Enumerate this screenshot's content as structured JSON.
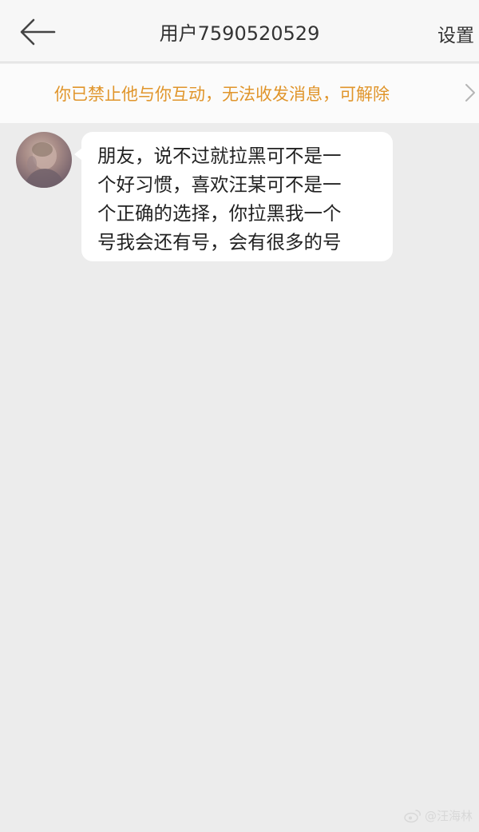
{
  "header": {
    "back_icon": "back-arrow-icon",
    "title": "用户7590520529",
    "settings_label": "设置"
  },
  "notice": {
    "text": "你已禁止他与你互动，无法收发消息，可解除",
    "chevron_icon": "chevron-right-icon",
    "text_color": "#e0952b"
  },
  "messages": [
    {
      "sender": "other",
      "avatar_icon": "avatar",
      "lines": [
        "朋友，说不过就拉黑可不是一",
        "个好习惯，喜欢汪某可不是一",
        "个正确的选择，你拉黑我一个",
        "号我会还有号，会有很多的号"
      ]
    }
  ],
  "watermark": {
    "icon": "weibo-logo-icon",
    "text": "@汪海林"
  },
  "colors": {
    "background": "#ececec",
    "header_bg": "#f7f7f7",
    "bubble_bg": "#ffffff",
    "notice_color": "#e0952b"
  }
}
